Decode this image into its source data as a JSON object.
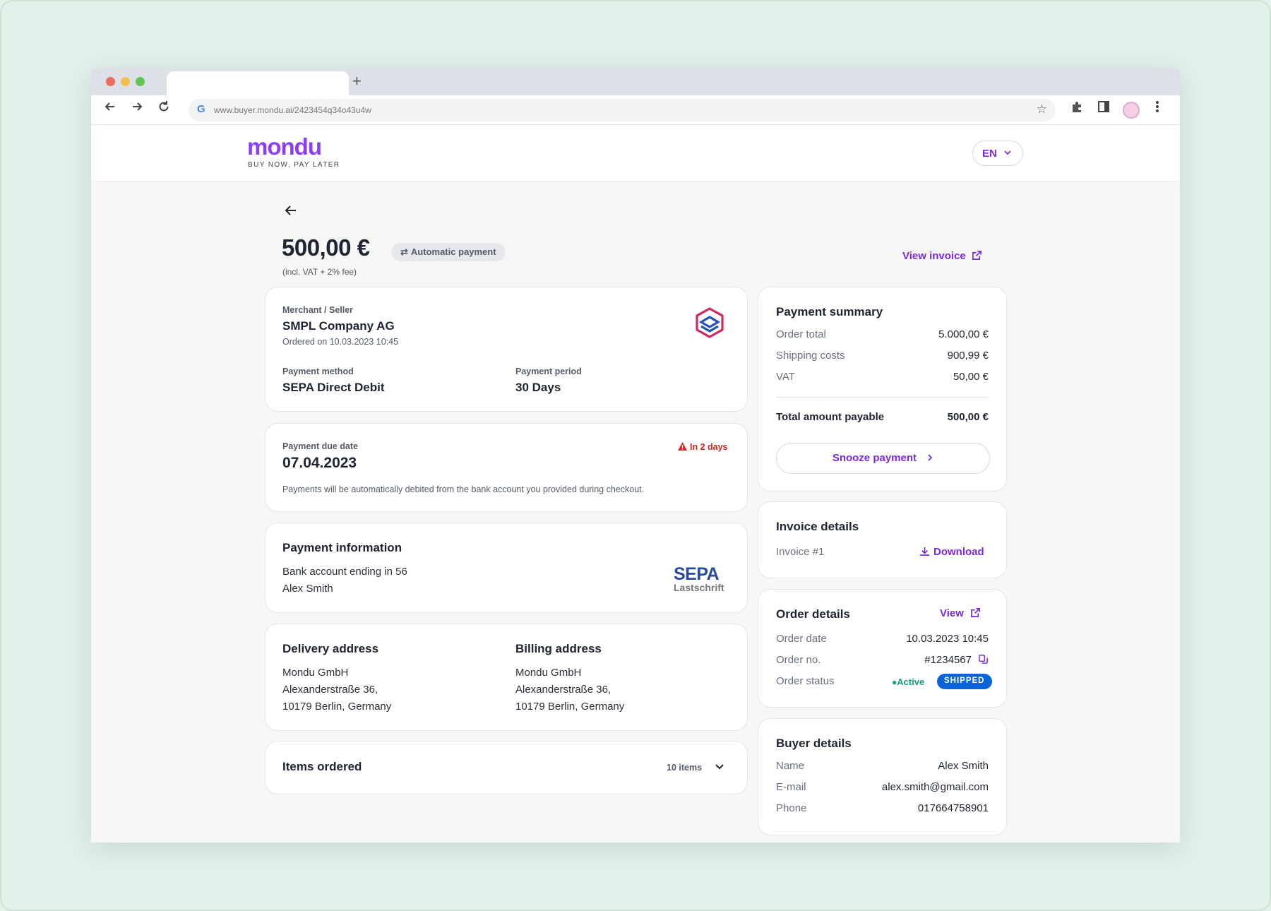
{
  "browser": {
    "url": "www.buyer.mondu.ai/2423454q34o43u4w",
    "new_tab": "+",
    "google_mark": "G"
  },
  "header": {
    "logo": "mondu",
    "tagline": "BUY NOW, PAY LATER",
    "language": "EN"
  },
  "summary": {
    "amount": "500,00 €",
    "payment_type": "Automatic payment",
    "fee_note": "(incl. VAT + 2% fee)",
    "view_invoice": "View invoice"
  },
  "merchant_card": {
    "merchant_label": "Merchant / Seller",
    "merchant_name": "SMPL Company AG",
    "ordered_on": "Ordered on 10.03.2023 10:45",
    "method_label": "Payment method",
    "method_value": "SEPA Direct Debit",
    "period_label": "Payment period",
    "period_value": "30 Days"
  },
  "due_card": {
    "label": "Payment due date",
    "date": "07.04.2023",
    "warning": "In 2 days",
    "note": "Payments will be automatically debited from the bank account you provided during checkout."
  },
  "payment_info": {
    "title": "Payment information",
    "account": "Bank account ending in 56",
    "holder": "Alex Smith",
    "sepa_top": "SEPA",
    "sepa_bottom": "Lastschrift"
  },
  "addresses": {
    "delivery_title": "Delivery address",
    "delivery_lines": [
      "Mondu GmbH",
      "Alexanderstraße 36,",
      "10179 Berlin, Germany"
    ],
    "billing_title": "Billing address",
    "billing_lines": [
      "Mondu GmbH",
      "Alexanderstraße 36,",
      "10179 Berlin, Germany"
    ]
  },
  "items": {
    "title": "Items ordered",
    "count": "10 items"
  },
  "payment_summary": {
    "title": "Payment summary",
    "rows": [
      {
        "label": "Order total",
        "value": "5.000,00 €"
      },
      {
        "label": "Shipping costs",
        "value": "900,99 €"
      },
      {
        "label": "VAT",
        "value": "50,00 €"
      }
    ],
    "total_label": "Total amount payable",
    "total_value": "500,00 €",
    "snooze": "Snooze payment"
  },
  "invoice_details": {
    "title": "Invoice details",
    "invoice": "Invoice #1",
    "download": "Download"
  },
  "order_details": {
    "title": "Order details",
    "view": "View",
    "date_label": "Order date",
    "date_value": "10.03.2023 10:45",
    "no_label": "Order no.",
    "no_value": "#1234567",
    "status_label": "Order status",
    "status_active": "Active",
    "status_shipped": "SHIPPED"
  },
  "buyer_details": {
    "title": "Buyer details",
    "rows": [
      {
        "label": "Name",
        "value": "Alex Smith"
      },
      {
        "label": "E-mail",
        "value": "alex.smith@gmail.com"
      },
      {
        "label": "Phone",
        "value": "017664758901"
      }
    ]
  },
  "colors": {
    "brand_purple": "#7a2ae0",
    "warning_red": "#d9241c",
    "active_green": "#12a07a",
    "shipped_blue": "#0a63d8"
  }
}
